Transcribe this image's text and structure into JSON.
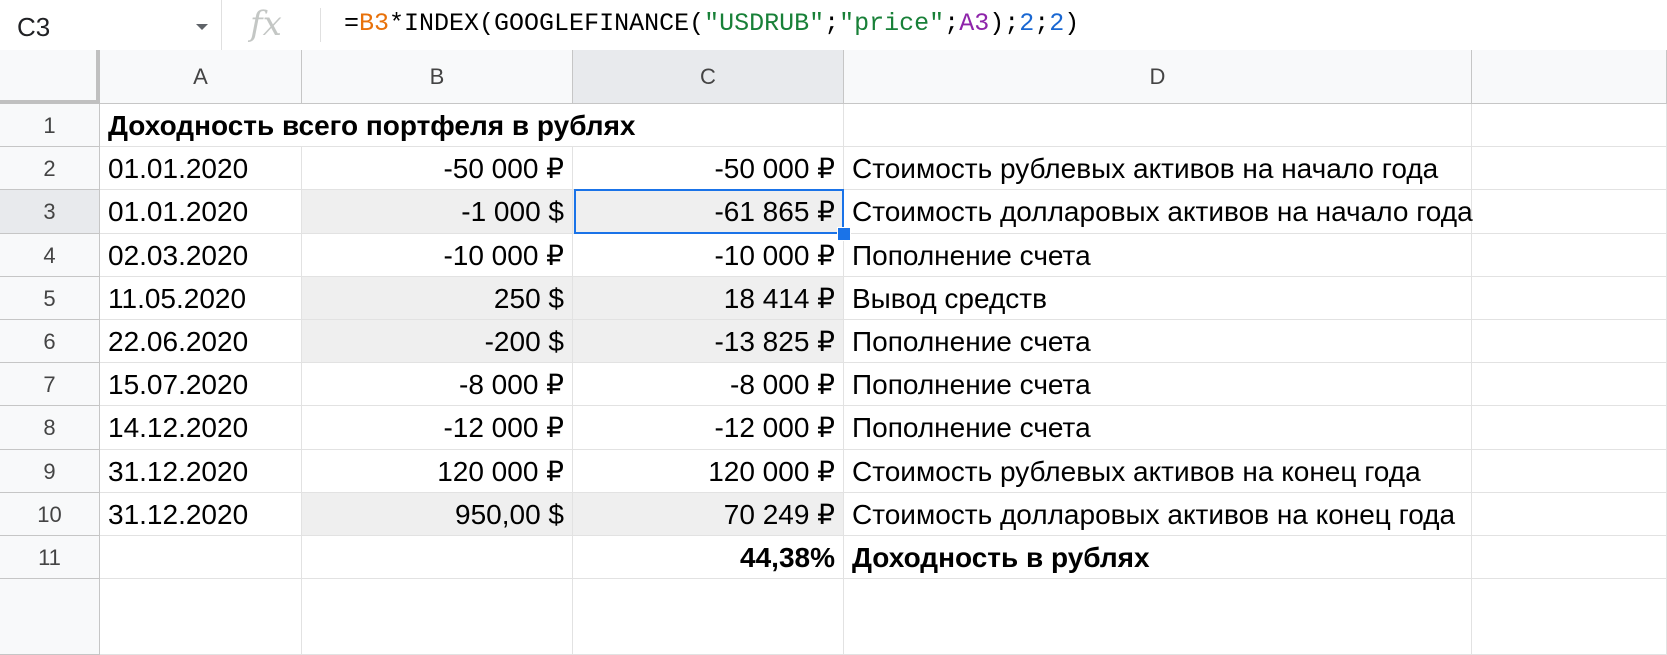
{
  "formula_bar": {
    "name_box": "C3",
    "fx_label": "fx",
    "formula_tokens": [
      {
        "text": "=",
        "kind": "plain"
      },
      {
        "text": "B3",
        "kind": "ref1"
      },
      {
        "text": "*INDEX(GOOGLEFINANCE(",
        "kind": "plain"
      },
      {
        "text": "\"USDRUB\"",
        "kind": "str"
      },
      {
        "text": ";",
        "kind": "plain"
      },
      {
        "text": "\"price\"",
        "kind": "str"
      },
      {
        "text": ";",
        "kind": "plain"
      },
      {
        "text": "A3",
        "kind": "ref2"
      },
      {
        "text": ");",
        "kind": "plain"
      },
      {
        "text": "2",
        "kind": "num"
      },
      {
        "text": ";",
        "kind": "plain"
      },
      {
        "text": "2",
        "kind": "num"
      },
      {
        "text": ")",
        "kind": "plain"
      }
    ]
  },
  "columns": [
    "A",
    "B",
    "C",
    "D"
  ],
  "selected_column": "C",
  "selected_row": "3",
  "rows": [
    {
      "num": "1",
      "a": "Доходность всего портфеля в рублях",
      "b": "",
      "c": "",
      "d": "",
      "bold": true,
      "gray_b": false,
      "gray_c": false
    },
    {
      "num": "2",
      "a": "01.01.2020",
      "b": "-50 000 ₽",
      "c": "-50 000 ₽",
      "d": "Стоимость рублевых активов на начало года",
      "gray_b": false,
      "gray_c": false
    },
    {
      "num": "3",
      "a": "01.01.2020",
      "b": "-1 000 $",
      "c": "-61 865 ₽",
      "d": "Стоимость долларовых активов на начало года",
      "gray_b": true,
      "gray_c": true
    },
    {
      "num": "4",
      "a": "02.03.2020",
      "b": "-10 000 ₽",
      "c": "-10 000 ₽",
      "d": "Пополнение счета",
      "gray_b": false,
      "gray_c": false
    },
    {
      "num": "5",
      "a": "11.05.2020",
      "b": "250 $",
      "c": "18 414 ₽",
      "d": "Вывод средств",
      "gray_b": true,
      "gray_c": true
    },
    {
      "num": "6",
      "a": "22.06.2020",
      "b": "-200 $",
      "c": "-13 825 ₽",
      "d": "Пополнение счета",
      "gray_b": true,
      "gray_c": true
    },
    {
      "num": "7",
      "a": "15.07.2020",
      "b": "-8 000 ₽",
      "c": "-8 000 ₽",
      "d": "Пополнение счета",
      "gray_b": false,
      "gray_c": false
    },
    {
      "num": "8",
      "a": "14.12.2020",
      "b": "-12 000 ₽",
      "c": "-12 000 ₽",
      "d": "Пополнение счета",
      "gray_b": false,
      "gray_c": false
    },
    {
      "num": "9",
      "a": "31.12.2020",
      "b": "120 000 ₽",
      "c": "120 000 ₽",
      "d": "Стоимость рублевых активов на конец года",
      "gray_b": false,
      "gray_c": false
    },
    {
      "num": "10",
      "a": "31.12.2020",
      "b": "950,00 $",
      "c": "70 249 ₽",
      "d": "Стоимость долларовых активов на конец года",
      "gray_b": true,
      "gray_c": true
    },
    {
      "num": "11",
      "a": "",
      "b": "",
      "c": "44,38%",
      "d": "Доходность в рублях",
      "bold_cd": true,
      "gray_b": false,
      "gray_c": false
    }
  ],
  "extra_row": {
    "num": ""
  }
}
